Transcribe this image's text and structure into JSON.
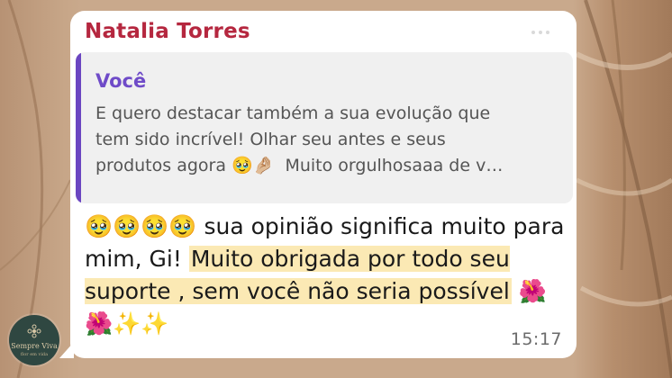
{
  "chat": {
    "sender_name": "Natalia Torres",
    "quoted": {
      "author": "Você",
      "line1": "E quero destacar também a sua evolução que",
      "line2": "tem sido incrível! Olhar seu antes e seus",
      "line3_text": "produtos agora",
      "line3_emojis": "🥹🤌🏼",
      "line3_tail": "Muito orgulhosaaa de v…"
    },
    "message": {
      "emojis": "🥹🥹🥹🥹",
      "text_plain": " sua opinião significa muito para mim, Gi! ",
      "text_highlighted": "Muito obrigada por todo seu suporte , sem você não seria possível",
      "trailing_emojis": "🌺🌺✨✨"
    },
    "timestamp": "15:17"
  },
  "watermark": {
    "brand": "Sempre Viva",
    "tagline": "flor em vida"
  },
  "colors": {
    "sender": "#b5273f",
    "quote_author": "#6f4bc8",
    "quote_bar": "#6b46c1",
    "highlight": "#fbe9b4"
  }
}
